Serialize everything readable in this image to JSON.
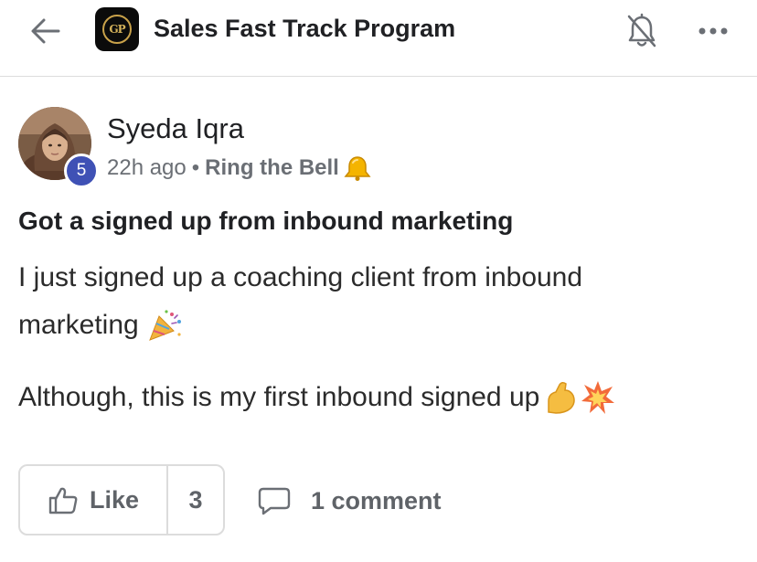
{
  "header": {
    "title": "Sales Fast Track Program",
    "logo_text": "GP",
    "icons": [
      "back-arrow-icon",
      "bell-off-icon",
      "more-icon"
    ]
  },
  "post": {
    "author": "Syeda Iqra",
    "level": "5",
    "time": "22h ago",
    "separator": "•",
    "category": "Ring the Bell",
    "title": "Got a signed up from inbound marketing",
    "line1": "I just signed up a coaching client from inbound",
    "line2": "marketing",
    "line3": "Although, this is my first inbound signed up"
  },
  "actions": {
    "like_label": "Like",
    "like_count": "3",
    "comment_label": "1 comment"
  },
  "colors": {
    "badge": "#3f51b5",
    "logo_gold": "#c9a24a",
    "divider": "#dcdcdc",
    "muted_text": "#5f6368"
  }
}
